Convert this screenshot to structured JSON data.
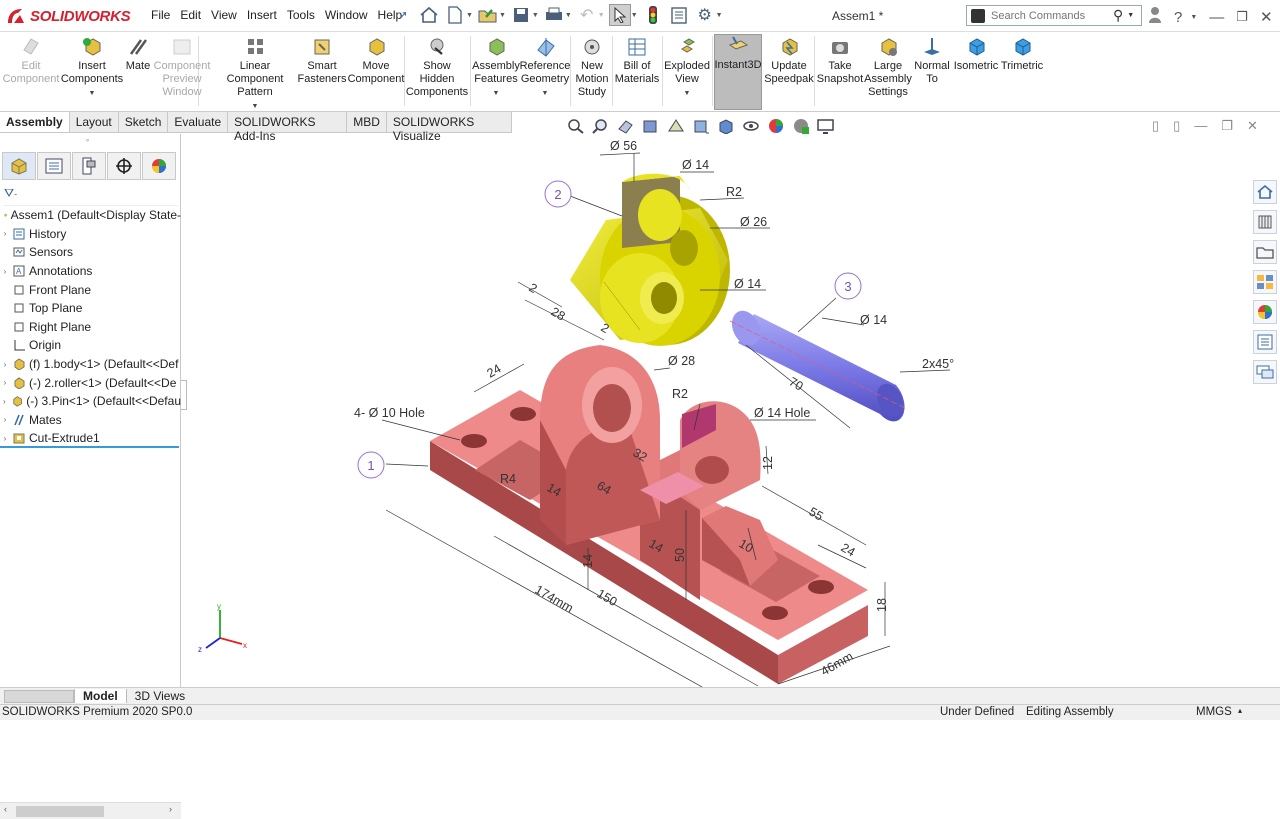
{
  "app": {
    "logo_text": "SOLIDWORKS",
    "document_title": "Assem1 *"
  },
  "menu": {
    "items": [
      "File",
      "Edit",
      "View",
      "Insert",
      "Tools",
      "Window",
      "Help"
    ]
  },
  "search": {
    "placeholder": "Search Commands"
  },
  "ribbon": {
    "buttons": [
      {
        "label": "Edit\nComponent",
        "icon": "edit-component-icon",
        "enabled": false
      },
      {
        "label": "Insert\nComponents",
        "icon": "insert-components-icon",
        "enabled": true
      },
      {
        "label": "Mate",
        "icon": "mate-icon",
        "enabled": true
      },
      {
        "label": "Component\nPreview\nWindow",
        "icon": "component-preview-icon",
        "enabled": false
      },
      {
        "label": "Linear Component\nPattern",
        "icon": "linear-pattern-icon",
        "enabled": true
      },
      {
        "label": "Smart\nFasteners",
        "icon": "smart-fasteners-icon",
        "enabled": true
      },
      {
        "label": "Move\nComponent",
        "icon": "move-component-icon",
        "enabled": true
      },
      {
        "label": "Show\nHidden\nComponents",
        "icon": "show-hidden-icon",
        "enabled": true
      },
      {
        "label": "Assembly\nFeatures",
        "icon": "assembly-features-icon",
        "enabled": true
      },
      {
        "label": "Reference\nGeometry",
        "icon": "reference-geometry-icon",
        "enabled": true
      },
      {
        "label": "New\nMotion\nStudy",
        "icon": "motion-study-icon",
        "enabled": true
      },
      {
        "label": "Bill of\nMaterials",
        "icon": "bill-of-materials-icon",
        "enabled": true
      },
      {
        "label": "Exploded\nView",
        "icon": "exploded-view-icon",
        "enabled": true
      },
      {
        "label": "Instant3D",
        "icon": "instant3d-icon",
        "enabled": true
      },
      {
        "label": "Update\nSpeedpak",
        "icon": "speedpak-icon",
        "enabled": true
      },
      {
        "label": "Take\nSnapshot",
        "icon": "snapshot-icon",
        "enabled": true
      },
      {
        "label": "Large\nAssembly\nSettings",
        "icon": "large-assembly-icon",
        "enabled": true
      },
      {
        "label": "Normal\nTo",
        "icon": "normal-to-icon",
        "enabled": true
      },
      {
        "label": "Isometric",
        "icon": "isometric-icon",
        "enabled": true
      },
      {
        "label": "Trimetric",
        "icon": "trimetric-icon",
        "enabled": true
      }
    ]
  },
  "tabs": [
    "Assembly",
    "Layout",
    "Sketch",
    "Evaluate",
    "SOLIDWORKS Add-Ins",
    "MBD",
    "SOLIDWORKS Visualize"
  ],
  "active_tab": "Assembly",
  "tree": {
    "items": [
      {
        "label": "Assem1  (Default<Display State-",
        "icon": "assembly-icon",
        "caret": false
      },
      {
        "label": "History",
        "icon": "history-icon",
        "caret": true
      },
      {
        "label": "Sensors",
        "icon": "sensors-icon",
        "caret": false
      },
      {
        "label": "Annotations",
        "icon": "annotations-icon",
        "caret": true
      },
      {
        "label": "Front Plane",
        "icon": "plane-icon",
        "caret": false
      },
      {
        "label": "Top Plane",
        "icon": "plane-icon",
        "caret": false
      },
      {
        "label": "Right Plane",
        "icon": "plane-icon",
        "caret": false
      },
      {
        "label": "Origin",
        "icon": "origin-icon",
        "caret": false
      },
      {
        "label": "(f) 1.body<1>  (Default<<Def",
        "icon": "part-icon",
        "caret": true
      },
      {
        "label": "(-) 2.roller<1>  (Default<<De",
        "icon": "part-icon",
        "caret": true
      },
      {
        "label": "(-) 3.Pin<1>  (Default<<Defau",
        "icon": "part-icon",
        "caret": true
      },
      {
        "label": "Mates",
        "icon": "mates-icon",
        "caret": true
      },
      {
        "label": "Cut-Extrude1",
        "icon": "cut-extrude-icon",
        "caret": true
      }
    ]
  },
  "bottom_tabs": [
    "Model",
    "3D Views"
  ],
  "status": {
    "product": "SOLIDWORKS Premium 2020 SP0.0",
    "state": "Under Defined",
    "mode": "Editing Assembly",
    "units": "MMGS"
  },
  "drawing": {
    "balloons": [
      "1",
      "2",
      "3"
    ],
    "dims": {
      "d56": "Ø 56",
      "d14a": "Ø 14",
      "r2a": "R2",
      "d26": "Ø 26",
      "d14b": "Ø 14",
      "two_a": "2",
      "e28": "28",
      "two_b": "2",
      "d14c": "Ø 14",
      "chamfer": "2x45°",
      "seventy": "70",
      "d28": "Ø 28",
      "r2b": "R2",
      "hole14": "Ø 14 Hole",
      "hole10": "4- Ø 10 Hole",
      "twentyfour_a": "24",
      "r4": "R4",
      "thirtytwo": "32",
      "sixtyfour": "64",
      "fourteen_a": "14",
      "twelve": "12",
      "fiftyfive": "55",
      "twentyfour_b": "24",
      "ten": "10",
      "fourteen_b": "14",
      "fourteen_c": "14",
      "fifty": "50",
      "eighteen": "18",
      "len174": "174mm",
      "len150": "150",
      "width46": "46mm"
    },
    "colors": {
      "body": "#e87a7a",
      "body_dark": "#c25a5a",
      "roller": "#d9d400",
      "roller_dark": "#a8a300",
      "pin": "#7b79e6",
      "pin_dark": "#5755c4",
      "balloon": "#9a72c9"
    }
  },
  "triad": {
    "x": "x",
    "y": "y",
    "z": "z"
  }
}
